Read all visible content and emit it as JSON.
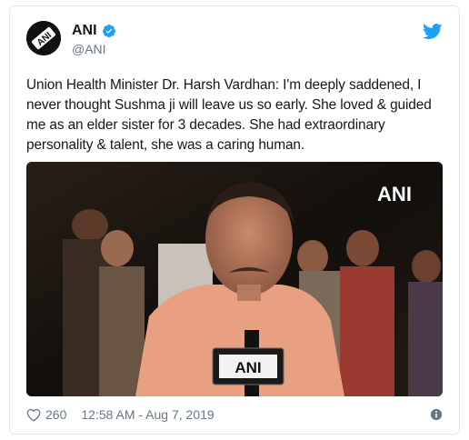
{
  "account": {
    "display_name": "ANI",
    "handle": "@ANI",
    "avatar_text": "ANI"
  },
  "tweet": {
    "text": "Union Health Minister Dr. Harsh Vardhan: I'm deeply saddened, I never thought Sushma ji will leave us so early. She loved & guided me as an elder sister for 3 decades. She had extraordinary personality & talent, she was a caring human."
  },
  "media": {
    "watermark": "ANI",
    "mic_label": "ANI"
  },
  "footer": {
    "like_count": "260",
    "timestamp": "12:58 AM - Aug 7, 2019"
  },
  "colors": {
    "twitter_blue": "#1da1f2",
    "secondary_text": "#657786",
    "border": "#e1e8ed"
  },
  "icons": [
    "verified-badge-icon",
    "twitter-bird-icon",
    "heart-icon",
    "info-icon"
  ]
}
